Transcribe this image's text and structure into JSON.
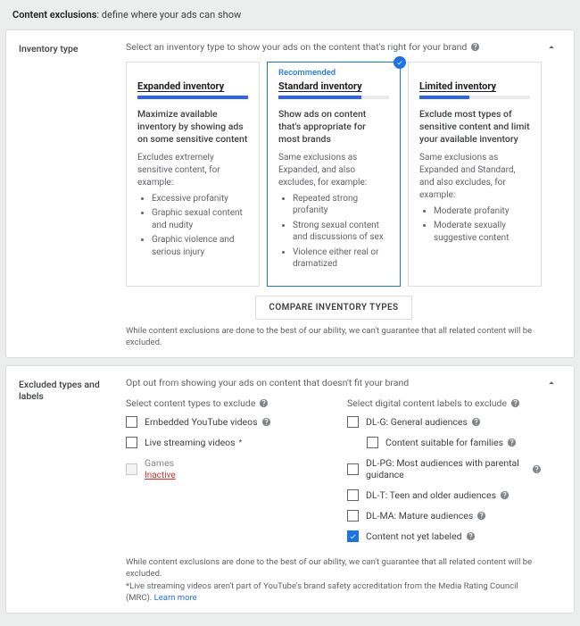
{
  "header": {
    "title": "Content exclusions",
    "desc": ": define where your ads can show"
  },
  "inventory": {
    "side_label": "Inventory type",
    "hint": "Select an inventory type to show your ads on the content that's right for your brand",
    "recommended_label": "Recommended",
    "cards": [
      {
        "title": "Expanded inventory",
        "fill_pct": 100,
        "selected": false,
        "desc": "Maximize available inventory by showing ads on some sensitive content",
        "sub": "Excludes extremely sensitive content, for example:",
        "bullets": [
          "Excessive profanity",
          "Graphic sexual content and nudity",
          "Graphic violence and serious injury"
        ]
      },
      {
        "title": "Standard inventory",
        "fill_pct": 75,
        "selected": true,
        "recommended": true,
        "desc": "Show ads on content that's appropriate for most brands",
        "sub": "Same exclusions as Expanded, and also excludes, for example:",
        "bullets": [
          "Repeated strong profanity",
          "Strong sexual content and discussions of sex",
          "Violence either real or dramatized"
        ]
      },
      {
        "title": "Limited inventory",
        "fill_pct": 45,
        "selected": false,
        "desc": "Exclude most types of sensitive content and limit your available inventory",
        "sub": "Same exclusions as Expanded and Standard, and also excludes, for example:",
        "bullets": [
          "Moderate profanity",
          "Moderate sexually suggestive content"
        ]
      }
    ],
    "compare_btn": "COMPARE INVENTORY TYPES",
    "disclaimer": "While content exclusions are done to the best of our ability, we can't guarantee that all related content will be excluded."
  },
  "excluded": {
    "side_label": "Excluded types and labels",
    "hint": "Opt out from showing your ads on content that doesn't fit your brand",
    "left_head": "Select content types to exclude",
    "right_head": "Select digital content labels to exclude",
    "left_opts": [
      {
        "label": "Embedded YouTube videos",
        "checked": false,
        "disabled": false,
        "help": true
      },
      {
        "label": "Live streaming videos",
        "checked": false,
        "disabled": false,
        "help": false,
        "asterisk": true
      },
      {
        "label": "Games",
        "checked": false,
        "disabled": true,
        "help": false,
        "inactive": true,
        "inactive_label": "Inactive"
      }
    ],
    "right_opts": [
      {
        "label": "DL-G: General audiences",
        "checked": false,
        "help": true,
        "indent": false
      },
      {
        "label": "Content suitable for families",
        "checked": false,
        "help": true,
        "indent": true
      },
      {
        "label": "DL-PG: Most audiences with parental guidance",
        "checked": false,
        "help": true,
        "indent": false
      },
      {
        "label": "DL-T: Teen and older audiences",
        "checked": false,
        "help": true,
        "indent": false
      },
      {
        "label": "DL-MA: Mature audiences",
        "checked": false,
        "help": true,
        "indent": false
      },
      {
        "label": "Content not yet labeled",
        "checked": true,
        "help": true,
        "indent": false
      }
    ],
    "disclaimer1": "While content exclusions are done to the best of our ability, we can't guarantee that all related content will be excluded.",
    "disclaimer2_pre": "*Live streaming videos aren't part of YouTube's brand safety accreditation from the Media Rating Council (MRC). ",
    "learn_more": "Learn more"
  }
}
